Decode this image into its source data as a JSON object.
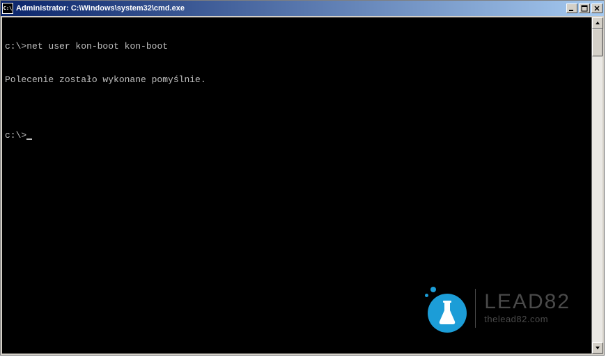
{
  "window": {
    "icon_text": "C:\\",
    "title": "Administrator: C:\\Windows\\system32\\cmd.exe"
  },
  "console": {
    "line1_prompt": "c:\\>",
    "line1_cmd": "net user kon-boot kon-boot",
    "line2_output": "Polecenie zostało wykonane pomyślnie.",
    "line3_blank": "",
    "line4_prompt": "c:\\>"
  },
  "watermark": {
    "brand": "LEAD82",
    "url": "thelead82.com"
  }
}
